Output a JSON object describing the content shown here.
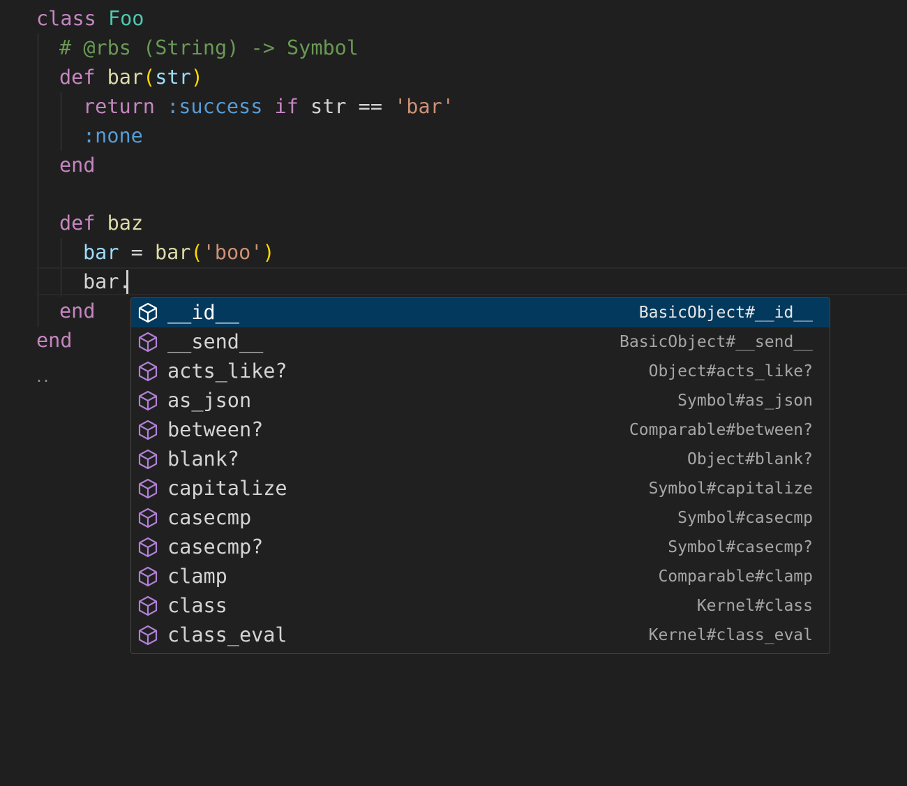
{
  "colors": {
    "background": "#1f1f1f",
    "keyword": "#c586c0",
    "class_name": "#4ec9b0",
    "function": "#dcdcaa",
    "variable": "#9cdcfe",
    "symbol": "#569cd6",
    "string": "#ce9178",
    "comment": "#6a9955",
    "bracket": "#ffd700",
    "plain": "#d4d4d4",
    "selection": "#04395e",
    "method_icon": "#b180d7"
  },
  "code_lines": [
    [
      {
        "t": "class ",
        "c": "keyword"
      },
      {
        "t": "Foo",
        "c": "class_name"
      }
    ],
    [
      {
        "t": "# @rbs (String) -> Symbol",
        "c": "comment"
      }
    ],
    [
      {
        "t": "def ",
        "c": "keyword"
      },
      {
        "t": "bar",
        "c": "function"
      },
      {
        "t": "(",
        "c": "bracket"
      },
      {
        "t": "str",
        "c": "variable"
      },
      {
        "t": ")",
        "c": "bracket"
      }
    ],
    [
      {
        "t": "return ",
        "c": "keyword"
      },
      {
        "t": ":success ",
        "c": "symbol"
      },
      {
        "t": "if ",
        "c": "keyword"
      },
      {
        "t": "str == ",
        "c": "plain"
      },
      {
        "t": "'bar'",
        "c": "string"
      }
    ],
    [
      {
        "t": ":none",
        "c": "symbol"
      }
    ],
    [
      {
        "t": "end",
        "c": "keyword"
      }
    ],
    [],
    [
      {
        "t": "def ",
        "c": "keyword"
      },
      {
        "t": "baz",
        "c": "function"
      }
    ],
    [
      {
        "t": "bar",
        "c": "variable"
      },
      {
        "t": " = ",
        "c": "plain"
      },
      {
        "t": "bar",
        "c": "function"
      },
      {
        "t": "(",
        "c": "bracket"
      },
      {
        "t": "'boo'",
        "c": "string"
      },
      {
        "t": ")",
        "c": "bracket"
      }
    ],
    [
      {
        "t": "bar.",
        "c": "plain"
      }
    ],
    [
      {
        "t": "end",
        "c": "keyword"
      }
    ],
    [
      {
        "t": "end",
        "c": "keyword"
      }
    ]
  ],
  "fold_marker": "..",
  "suggestions": [
    {
      "label": "__id__",
      "detail": "BasicObject#__id__",
      "icon": "method-cube-icon",
      "selected": true
    },
    {
      "label": "__send__",
      "detail": "BasicObject#__send__",
      "icon": "method-cube-icon"
    },
    {
      "label": "acts_like?",
      "detail": "Object#acts_like?",
      "icon": "method-cube-icon"
    },
    {
      "label": "as_json",
      "detail": "Symbol#as_json",
      "icon": "method-cube-icon"
    },
    {
      "label": "between?",
      "detail": "Comparable#between?",
      "icon": "method-cube-icon"
    },
    {
      "label": "blank?",
      "detail": "Object#blank?",
      "icon": "method-cube-icon"
    },
    {
      "label": "capitalize",
      "detail": "Symbol#capitalize",
      "icon": "method-cube-icon"
    },
    {
      "label": "casecmp",
      "detail": "Symbol#casecmp",
      "icon": "method-cube-icon"
    },
    {
      "label": "casecmp?",
      "detail": "Symbol#casecmp?",
      "icon": "method-cube-icon"
    },
    {
      "label": "clamp",
      "detail": "Comparable#clamp",
      "icon": "method-cube-icon"
    },
    {
      "label": "class",
      "detail": "Kernel#class",
      "icon": "method-cube-icon"
    },
    {
      "label": "class_eval",
      "detail": "Kernel#class_eval",
      "icon": "method-cube-icon"
    }
  ]
}
